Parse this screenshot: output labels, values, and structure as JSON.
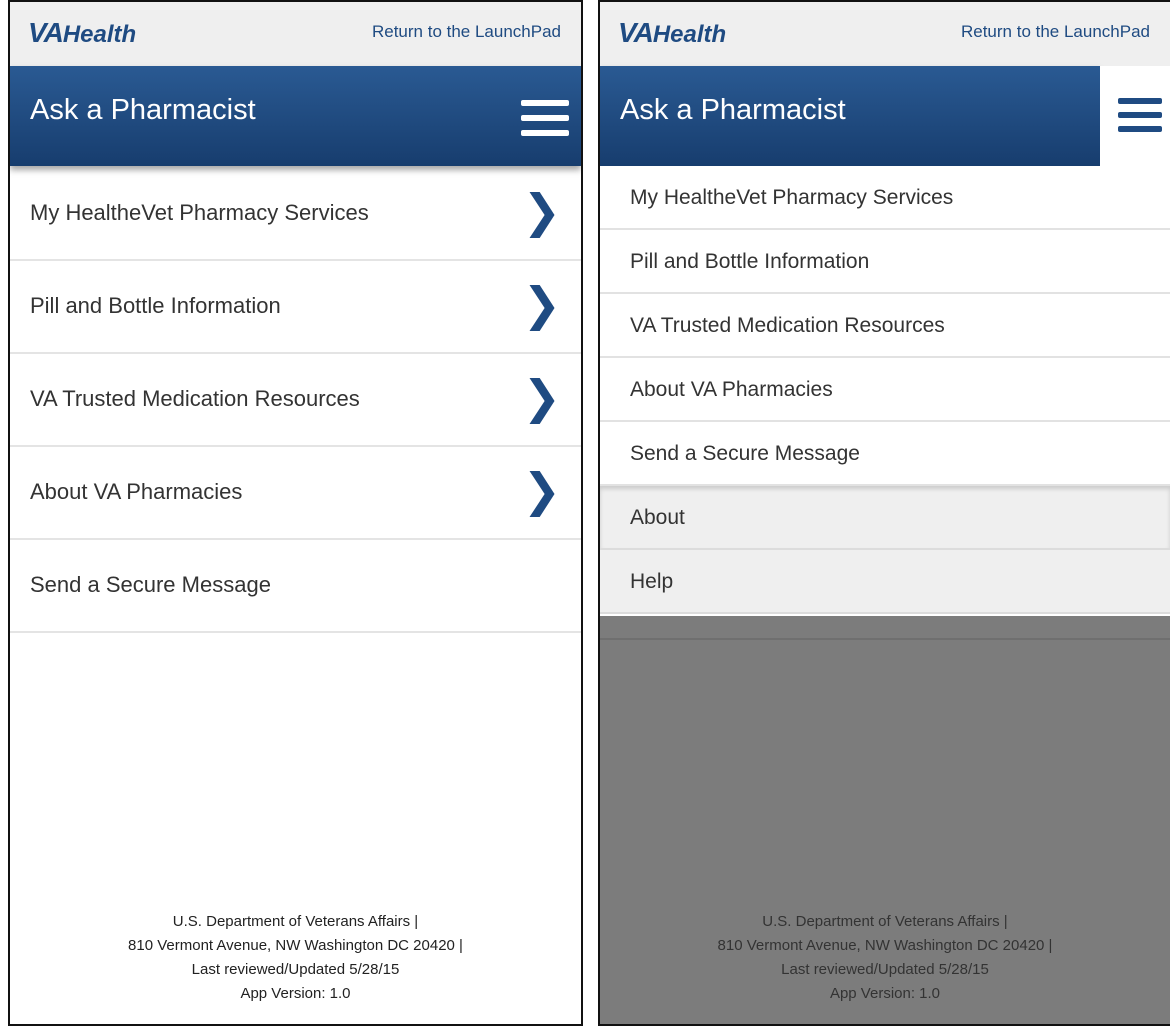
{
  "brand": {
    "va": "VA",
    "health": "Health"
  },
  "return_link": "Return to the LaunchPad",
  "page_title": "Ask a Pharmacist",
  "menu": [
    {
      "label": "My HealtheVet Pharmacy Services",
      "has_chevron": true
    },
    {
      "label": "Pill and Bottle Information",
      "has_chevron": true
    },
    {
      "label": "VA Trusted Medication Resources",
      "has_chevron": true
    },
    {
      "label": "About VA Pharmacies",
      "has_chevron": true
    },
    {
      "label": "Send a Secure Message",
      "has_chevron": false
    }
  ],
  "drawer": {
    "items": [
      "My HealtheVet Pharmacy Services",
      "Pill and Bottle Information",
      "VA Trusted Medication Resources",
      "About VA Pharmacies",
      "Send a Secure Message"
    ],
    "secondary": [
      "About",
      "Help"
    ]
  },
  "footer": {
    "line1": "U.S. Department of Veterans Affairs |",
    "line2": "810 Vermont Avenue, NW Washington DC 20420 |",
    "line3": "Last reviewed/Updated 5/28/15",
    "line4": "App Version: 1.0"
  },
  "icons": {
    "menu": "hamburger-menu-icon",
    "chevron": "chevron-right-icon"
  },
  "colors": {
    "brand_blue": "#1f4b82",
    "header_top": "#2a5a93",
    "header_bottom": "#173d6e",
    "overlay": "#7c7c7c"
  }
}
